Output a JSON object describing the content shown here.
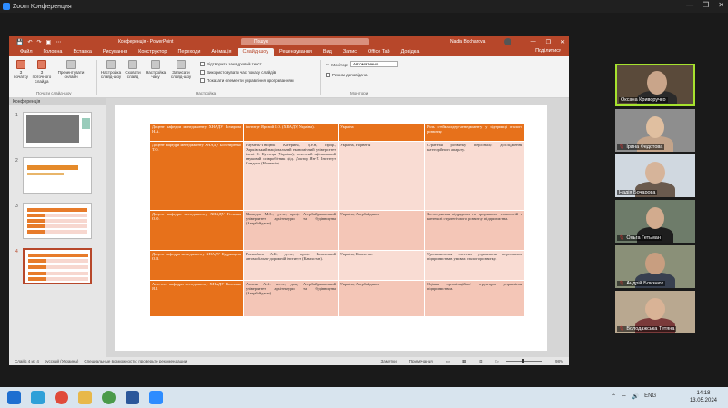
{
  "zoom": {
    "title": "Zoom Конференция"
  },
  "powerpoint": {
    "qat": [
      "💾",
      "↶",
      "↷",
      "▣",
      "⋯"
    ],
    "doc_title": "Конференція - PowerPoint",
    "search_placeholder": "Пошук",
    "user": "Nadia Bocharova",
    "user_initials": "NB",
    "window_buttons": [
      "—",
      "❐",
      "✕"
    ],
    "share": "Поділитися",
    "tabs": [
      "Файл",
      "Головна",
      "Вставка",
      "Рисування",
      "Конструктор",
      "Переходи",
      "Анімація",
      "Слайд-шоу",
      "Рецензування",
      "Вид",
      "Запис",
      "Office Tab",
      "Довідка"
    ],
    "active_tab": "Слайд-шоу",
    "ribbon": {
      "start": {
        "from_start": "З початку",
        "from_current": "З поточного слайда",
        "present_online": "Презентувати онлайн",
        "custom": "Довільний слайд-шоу"
      },
      "group_start": "Почати слайд-шоу",
      "setup": {
        "setup_show": "Настройка слайд-шоу",
        "hide_slide": "Сховати слайд",
        "rehearse": "Настройка часу",
        "record": "Записати слайд-шоу"
      },
      "checks": [
        "Відтворити закадровий текст",
        "Використовувати час показу слайдів",
        "Показати елементи управління програванням"
      ],
      "group_setup": "Настройка",
      "monitor_label": "Монітор:",
      "monitor_value": "Автоматично",
      "presenter_view": "Режим доповідача",
      "group_monitors": "Монітори"
    },
    "thumbs_header": "Конференція",
    "slide_numbers": [
      "1",
      "2",
      "3",
      "4"
    ],
    "table": [
      {
        "c1": "Доцент кафедри менеджменту ХНАДУ Бочарова Н.А.",
        "c2": "інститут Ярсний І.О. (ХНАДУ, Україна).",
        "c3": "Україна",
        "c4": "Роль стейкхолдер-менеджменту у підтримці сталого розвитку."
      },
      {
        "c1": "Доцент кафедри менеджменту ХНАДУ Богатиренко Т.О.",
        "c2": "Наумець-Гнидюк Катерина, д.е.н, проф., Харківський національний економічний університет імені С. Кузнеця (Україна), почесний афільований науковий співробітник фід. Доктор Ян-У. Інститут Сандиля (Норвегія).",
        "c3": "Україна, Норвегія",
        "c4": "Стратегія розвитку персоналу: дослідження категорійного апарату."
      },
      {
        "c1": "Доцент кафедри менеджменту ХНАДУ Гетьман О.О.",
        "c2": "Мамедов М.А., д.е.н., проф. Азербайджанський університет архітектури та будівництва (Азербайджан).",
        "c3": "Україна, Азербайджан",
        "c4": "Застосування підрядних та проривних технологій в контексті стратегічного розвитку підприємства."
      },
      {
        "c1": "Доцент кафедри менеджменту ХНАДУ Кудрявцева О.В.",
        "c2": "Рахимбаєв А.Б., д.т.н., проф. Казахський автомобільно-дорожній інститут (Казахстан).",
        "c3": "Україна, Казахстан",
        "c4": "Удосконалення системи управління персоналом підприємства в умовах сталого розвитку."
      },
      {
        "c1": "Асистент кафедри менеджменту ХНАДУ Волошко Я.І.",
        "c2": "Алиєва А.А. к.е.н., доц. Азербайджанський університет архітектури та будівництва (Азербайджан).",
        "c3": "Україна, Азербайджан",
        "c4": "Оцінка організаційної структури управління підприємством."
      }
    ],
    "status": {
      "slide": "Слайд 4 из 4",
      "lang": "русский (Украина)",
      "accessibility": "Специальные возможности: проверьте рекомендации",
      "notes": "Заметки",
      "comments": "Примечания",
      "zoom": "98%"
    }
  },
  "participants": [
    {
      "name": "Оксана Криворучко",
      "muted": false,
      "active": true
    },
    {
      "name": "Ірина Федотова",
      "muted": true,
      "active": false
    },
    {
      "name": "Надія Бочарова",
      "muted": false,
      "active": false
    },
    {
      "name": "Ольга Гетьман",
      "muted": true,
      "active": false
    },
    {
      "name": "Андрій Близнюк",
      "muted": true,
      "active": false
    },
    {
      "name": "Володажська Тетяна",
      "muted": true,
      "active": false
    }
  ],
  "taskbar": {
    "time": "14:18",
    "date": "13.05.2024",
    "lang": "ENG"
  },
  "colors": {
    "ppt_brand": "#b7472a",
    "table_orange": "#e7711b",
    "table_pink": "#f9dcd3"
  }
}
